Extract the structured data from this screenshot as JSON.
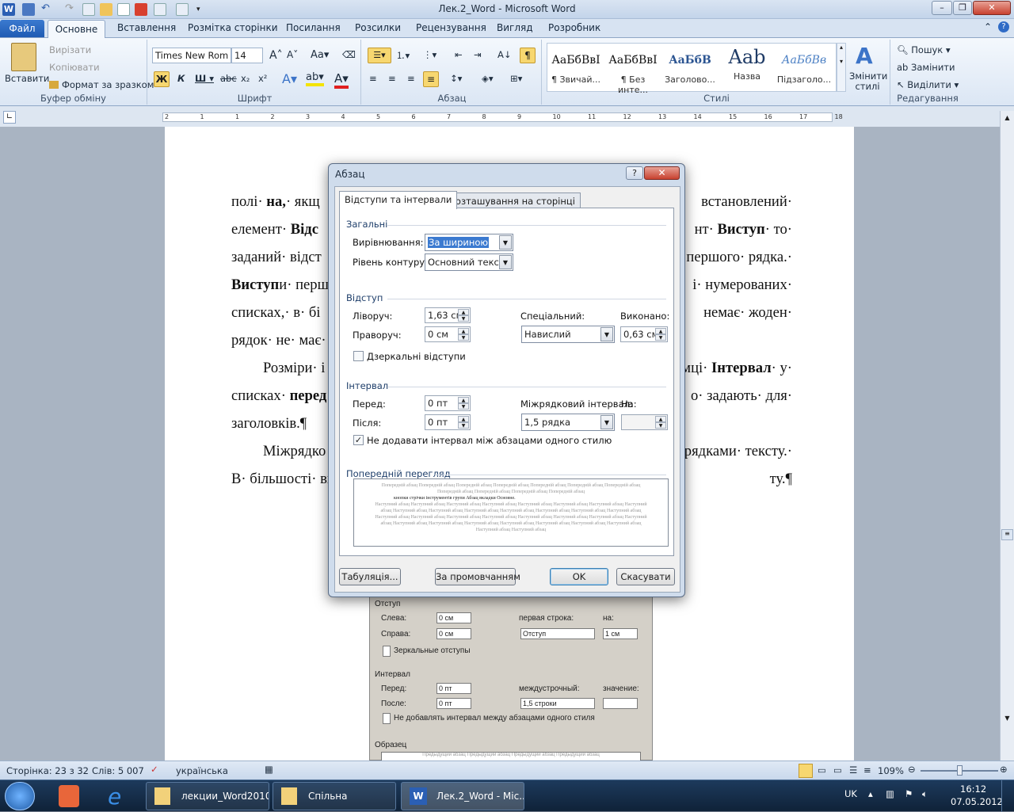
{
  "window": {
    "title": "Лек.2_Word  -  Microsoft Word"
  },
  "ribbon_tabs": [
    "Файл",
    "Основне",
    "Вставлення",
    "Розмітка сторінки",
    "Посилання",
    "Розсилки",
    "Рецензування",
    "Вигляд",
    "Розробник"
  ],
  "clipboard": {
    "paste": "Вставити",
    "cut": "Вирізати",
    "copy": "Копіювати",
    "format_painter": "Формат за зразком",
    "label": "Буфер обміну"
  },
  "font": {
    "name": "Times New Rom",
    "size": "14",
    "label": "Шрифт"
  },
  "paragraph": {
    "label": "Абзац"
  },
  "styles": {
    "tiles": [
      {
        "sample": "АаБбВвІ",
        "name": "¶ Звичай..."
      },
      {
        "sample": "АаБбВвІ",
        "name": "¶ Без инте..."
      },
      {
        "sample": "АаБбВ",
        "name": "Заголово..."
      },
      {
        "sample": "Aab",
        "name": "Назва"
      },
      {
        "sample": "АаБбВв",
        "name": "Підзаголо..."
      }
    ],
    "change": "Змінити стилі",
    "label": "Стилі"
  },
  "editing": {
    "find": "Пошук",
    "replace": "Замінити",
    "select": "Виділити",
    "label": "Редагування"
  },
  "ruler_ticks": [
    "2",
    "1",
    "1",
    "2",
    "3",
    "4",
    "5",
    "6",
    "7",
    "8",
    "9",
    "10",
    "11",
    "12",
    "13",
    "14",
    "15",
    "16",
    "17",
    "18"
  ],
  "document": {
    "lines": [
      {
        "left": "полі· на,· якщ",
        "right": "встановлений·"
      },
      {
        "left": "елемент· Відс",
        "right": "нт· Виступ· то·"
      },
      {
        "left": "заданий· відст",
        "right": "першого· рядка.·"
      },
      {
        "left": "Виступи· перш",
        "right": "і· нумерованих·"
      },
      {
        "left": "списках,· в· бі",
        "right": "немає· жоден·"
      },
      {
        "left": "рядок· не· має·",
        "right": ""
      },
      {
        "left": "Розміри· і",
        "right": "мці· Інтервал· у·"
      },
      {
        "left": "списках· перед",
        "right": "о· задають· для·"
      },
      {
        "left": "заголовків.¶",
        "right": ""
      },
      {
        "left": "Міжрядко",
        "right": "рядками· тексту.·"
      },
      {
        "left": "В· більшості· ви",
        "right": "ту.¶"
      }
    ]
  },
  "old_dialog": {
    "indent": "Отступ",
    "left": "Слева:",
    "left_val": "0 см",
    "right": "Справа:",
    "right_val": "0 см",
    "first": "первая строка:",
    "first_val": "Отступ",
    "on": "на:",
    "on_val": "1 см",
    "mirror": "Зеркальные отступы",
    "interval": "Интервал",
    "before": "Перед:",
    "before_val": "0 пт",
    "after": "После:",
    "after_val": "0 пт",
    "line": "междустрочный:",
    "line_val": "1,5 строки",
    "value": "значение:",
    "no_add": "Не добавлять интервал между абзацами одного стиля",
    "sample": "Образец",
    "sample_text": "Предыдущий абзац Предыдущий абзац Предыдущий абзац Предыдущий абзац"
  },
  "dialog": {
    "title": "Абзац",
    "tab1": "Відступи та інтервали",
    "tab2": "Розташування на сторінці",
    "general": "Загальні",
    "alignment_label": "Вирівнювання:",
    "alignment": "За шириною",
    "outline_label": "Рівень контуру:",
    "outline": "Основний текст",
    "indent": "Відступ",
    "left_label": "Ліворуч:",
    "left": "1,63 см",
    "right_label": "Праворуч:",
    "right": "0 см",
    "special_label": "Спеціальний:",
    "special": "Навислий",
    "by_label": "Виконано:",
    "by": "0,63 см",
    "mirror": "Дзеркальні відступи",
    "spacing": "Інтервал",
    "before_label": "Перед:",
    "before": "0 пт",
    "after_label": "Після:",
    "after": "0 пт",
    "line_label": "Міжрядковий інтервал:",
    "line": "1,5 рядка",
    "at_label": "На:",
    "at": "",
    "no_space": "Не додавати інтервал між абзацами одного стилю",
    "no_space_checked": true,
    "mirror_checked": false,
    "preview_label": "Попередній перегляд",
    "preview_prev": "Попередній абзац Попередній абзац Попередній абзац Попередній абзац Попередній абзац Попередній абзац Попередній абзац Попередній абзац Попередній абзац Попередній абзац Попередній абзац",
    "preview_cur": "кнопки стрічки інструментів групи Абзац вкладки Основне.",
    "preview_next": "Наступний абзац Наступний абзац Наступний абзац Наступний абзац Наступний абзац Наступний абзац Наступний абзац Наступний абзац Наступний абзац Наступний абзац Наступний абзац Наступний абзац Наступний абзац Наступний абзац Наступний абзац Наступний абзац Наступний абзац Наступний абзац Наступний абзац Наступний абзац Наступний абзац Наступний абзац Наступний абзац Наступний абзац Наступний абзац Наступний абзац Наступний абзац Наступний абзац Наступний абзац Наступний абзац Наступний абзац Наступний абзац",
    "tabs_btn": "Табуляція...",
    "default_btn": "За промовчанням",
    "ok": "OK",
    "cancel": "Скасувати"
  },
  "statusbar": {
    "page": "Сторінка: 23 з 32",
    "words": "Слів: 5 007",
    "lang": "українська",
    "zoom": "109%"
  },
  "taskbar": {
    "items": [
      "лекции_Word2010",
      "Спільна",
      "Лек.2_Word - Mic..."
    ],
    "lang": "UK",
    "time": "16:12",
    "date": "07.05.2012"
  }
}
